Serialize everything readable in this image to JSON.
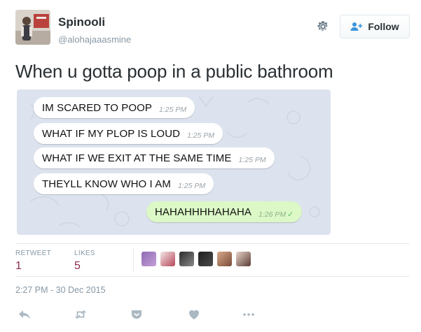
{
  "user": {
    "name": "Spinooli",
    "handle": "@alohajaaasmine"
  },
  "follow_label": "Follow",
  "tweet_text": "When u gotta poop in a public bathroom",
  "chat": {
    "messages": [
      {
        "text": "IM SCARED TO POOP",
        "time": "1:25 PM",
        "outgoing": false
      },
      {
        "text": "WHAT IF MY PLOP IS LOUD",
        "time": "1:25 PM",
        "outgoing": false
      },
      {
        "text": "WHAT IF WE EXIT AT THE SAME TIME",
        "time": "1:25 PM",
        "outgoing": false
      },
      {
        "text": "THEYLL KNOW WHO I AM",
        "time": "1:25 PM",
        "outgoing": false
      },
      {
        "text": "HAHAHHHHAHAHA",
        "time": "1:26 PM",
        "outgoing": true
      }
    ],
    "read_mark": "✓"
  },
  "stats": {
    "retweet_label": "RETWEET",
    "retweet_count": "1",
    "likes_label": "LIKES",
    "likes_count": "5"
  },
  "timestamp": "2:27 PM - 30 Dec 2015",
  "icons": {
    "settings": "gear-icon",
    "follow": "add-user-icon",
    "reply": "reply-icon",
    "retweet": "retweet-icon",
    "pocket": "pocket-icon",
    "like": "heart-icon",
    "more": "more-dots-icon"
  },
  "colors": {
    "count": "#8c2f49",
    "muted": "#8899a6",
    "outgoing_bubble": "#dbf8c6",
    "chat_background": "#dde3ee"
  }
}
